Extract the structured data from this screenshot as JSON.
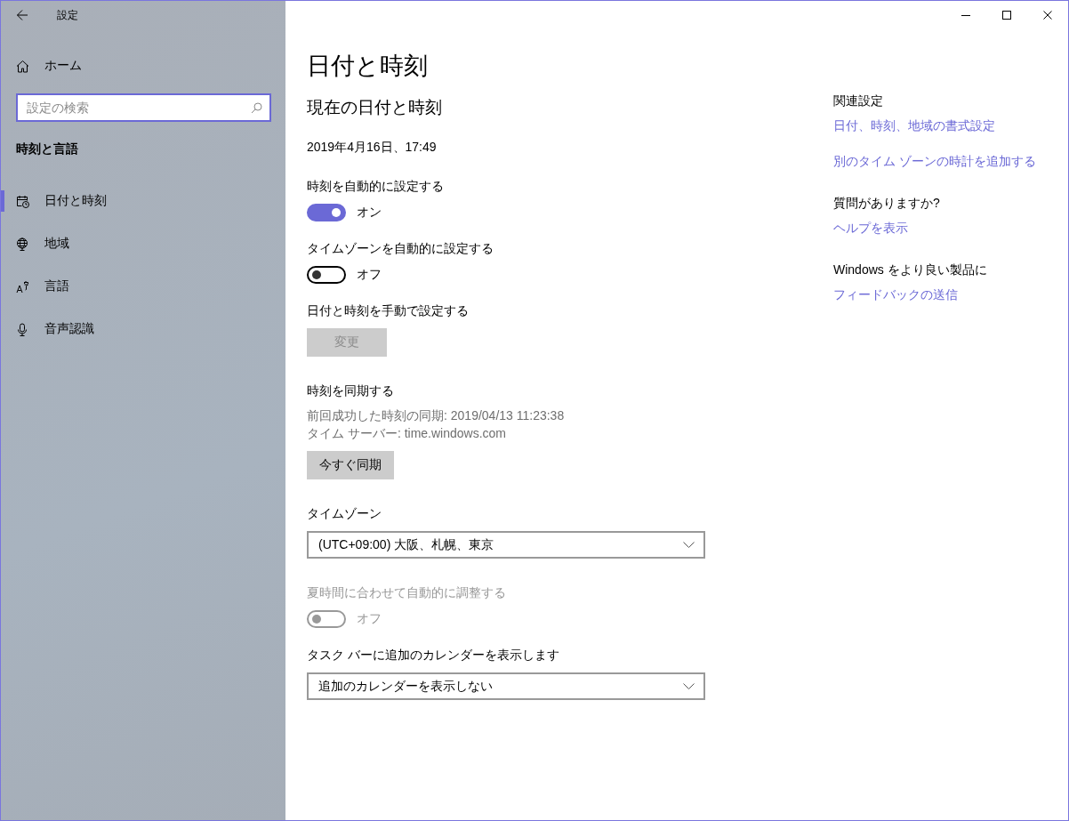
{
  "window": {
    "title": "設定"
  },
  "sidebar": {
    "home": "ホーム",
    "search": {
      "placeholder": "設定の検索"
    },
    "section": "時刻と言語",
    "items": [
      {
        "kind": "datetime",
        "label": "日付と時刻",
        "selected": true
      },
      {
        "kind": "region",
        "label": "地域",
        "selected": false
      },
      {
        "kind": "language",
        "label": "言語",
        "selected": false
      },
      {
        "kind": "speech",
        "label": "音声認識",
        "selected": false
      }
    ]
  },
  "main": {
    "title": "日付と時刻",
    "subtitle": "現在の日付と時刻",
    "current": "2019年4月16日、17:49",
    "settings": [
      {
        "kind": "toggle",
        "label": "時刻を自動的に設定する",
        "on": true,
        "disabled": false,
        "state": "オン"
      },
      {
        "kind": "toggle",
        "label": "タイムゾーンを自動的に設定する",
        "on": false,
        "disabled": false,
        "state": "オフ"
      },
      {
        "kind": "button",
        "label": "日付と時刻を手動で設定する",
        "button": "変更",
        "disabled": true
      },
      {
        "kind": "sync",
        "label": "時刻を同期する",
        "details": [
          "前回成功した時刻の同期: 2019/04/13 11:23:38",
          "タイム サーバー: time.windows.com"
        ],
        "button": "今すぐ同期",
        "disabled": false
      },
      {
        "kind": "dropdown",
        "label": "タイムゾーン",
        "value": "(UTC+09:00) 大阪、札幌、東京"
      },
      {
        "kind": "toggle",
        "label": "夏時間に合わせて自動的に調整する",
        "on": false,
        "disabled": true,
        "state": "オフ"
      },
      {
        "kind": "dropdown",
        "label": "タスク バーに追加のカレンダーを表示します",
        "value": "追加のカレンダーを表示しない"
      }
    ]
  },
  "related": [
    {
      "heading": "関連設定",
      "links": [
        "日付、時刻、地域の書式設定",
        "別のタイム ゾーンの時計を追加する"
      ]
    },
    {
      "heading": "質問がありますか?",
      "links": [
        "ヘルプを表示"
      ]
    },
    {
      "heading": "Windows をより良い製品に",
      "links": [
        "フィードバックの送信"
      ]
    }
  ]
}
